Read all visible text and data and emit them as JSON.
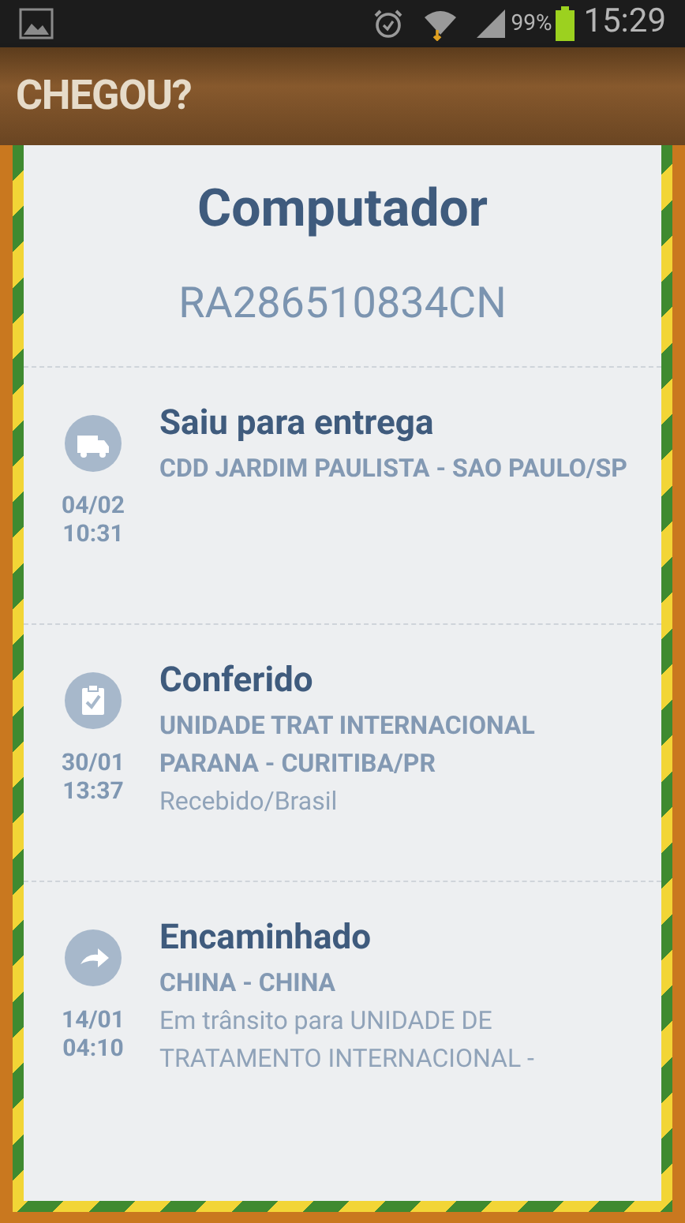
{
  "status_bar": {
    "battery": "99%",
    "time": "15:29"
  },
  "app_bar": {
    "title": "CHEGOU?"
  },
  "package": {
    "name": "Computador",
    "tracking_code": "RA286510834CN"
  },
  "events": [
    {
      "kind": "truck",
      "date": "04/02",
      "time": "10:31",
      "title": "Saiu para entrega",
      "location": "CDD JARDIM PAULISTA - SAO PAULO/SP"
    },
    {
      "kind": "clipboard",
      "date": "30/01",
      "time": "13:37",
      "title": "Conferido",
      "location": "UNIDADE TRAT INTERNACIONAL PARANA - CURITIBA/PR",
      "detail": "Recebido/Brasil"
    },
    {
      "kind": "forward",
      "date": "14/01",
      "time": "04:10",
      "title": "Encaminhado",
      "location": "CHINA - CHINA",
      "detail": "Em trânsito para UNIDADE DE TRATAMENTO INTERNACIONAL -"
    }
  ]
}
